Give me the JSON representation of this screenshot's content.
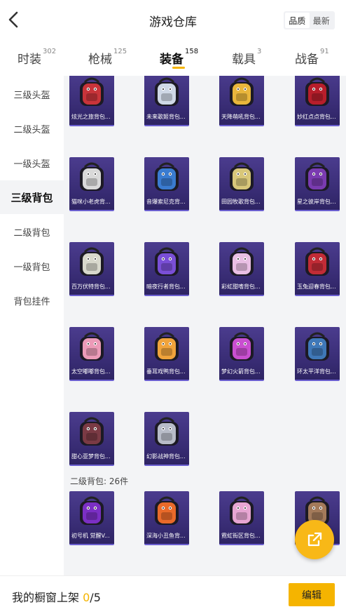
{
  "header": {
    "title": "游戏仓库",
    "sort_options": [
      "品质",
      "最新"
    ],
    "sort_selected": "品质"
  },
  "tabs": [
    {
      "label": "时装",
      "count": "302"
    },
    {
      "label": "枪械",
      "count": "125"
    },
    {
      "label": "装备",
      "count": "158",
      "active": true
    },
    {
      "label": "载具",
      "count": "3"
    },
    {
      "label": "战备",
      "count": "91"
    }
  ],
  "sidebar": {
    "items": [
      "三级头盔",
      "二级头盔",
      "一级头盔",
      "三级背包",
      "二级背包",
      "一级背包",
      "背包挂件"
    ],
    "active_index": 3
  },
  "items": [
    {
      "name": "炫光之旅背包...",
      "icon": "red-monster-backpack-icon",
      "color": "#c8343a"
    },
    {
      "name": "未来歌姬背包...",
      "icon": "white-idol-backpack-icon",
      "color": "#cfd8e6"
    },
    {
      "name": "天降萌吼背包...",
      "icon": "yellow-bear-backpack-icon",
      "color": "#e9b63c"
    },
    {
      "name": "妙红点点背包...",
      "icon": "red-dot-backpack-icon",
      "color": "#b71e2b"
    },
    {
      "name": "猫咪小老虎背...",
      "icon": "tiger-cat-backpack-icon",
      "color": "#d9d9d9"
    },
    {
      "name": "音爆索尼克背...",
      "icon": "sonic-robot-backpack-icon",
      "color": "#3a7bd0"
    },
    {
      "name": "田园牧歌背包...",
      "icon": "pastoral-basket-backpack-icon",
      "color": "#d8c77a"
    },
    {
      "name": "星之彼岸背包...",
      "icon": "star-shore-backpack-icon",
      "color": "#7a3bb0"
    },
    {
      "name": "百万伏特背包...",
      "icon": "volt-backpack-icon",
      "color": "#d8d8cc"
    },
    {
      "name": "暗夜行者背包...",
      "icon": "night-walker-backpack-icon",
      "color": "#7a4fd6"
    },
    {
      "name": "彩虹甜嗜背包...",
      "icon": "rainbow-bunny-backpack-icon",
      "color": "#e9bfe4"
    },
    {
      "name": "玉兔迎春背包...",
      "icon": "jade-rabbit-backpack-icon",
      "color": "#c12c36"
    },
    {
      "name": "太空嘟嘟背包...",
      "icon": "space-dudu-backpack-icon",
      "color": "#ec9bb8"
    },
    {
      "name": "垂耳戏鸭背包...",
      "icon": "floppy-duck-backpack-icon",
      "color": "#f0a33b"
    },
    {
      "name": "梦幻火箭背包...",
      "icon": "dream-rocket-backpack-icon",
      "color": "#c94fd0"
    },
    {
      "name": "环太平洋背包...",
      "icon": "pacific-rim-backpack-icon",
      "color": "#3f78b8"
    },
    {
      "name": "甜心亚梦背包...",
      "icon": "sweetheart-dream-backpack-icon",
      "color": "#7a3a44"
    },
    {
      "name": "幻影战神背包...",
      "icon": "phantom-war-backpack-icon",
      "color": "#b8bcc8"
    }
  ],
  "section2": {
    "label": "二级背包: 26件",
    "items": [
      {
        "name": "初号机 觉醒V...",
        "icon": "eva-unit01-backpack-icon",
        "color": "#7b2fc4"
      },
      {
        "name": "深海小丑鱼背...",
        "icon": "clownfish-backpack-icon",
        "color": "#e96a2a"
      },
      {
        "name": "霓虹街区背包...",
        "icon": "neon-street-backpack-icon",
        "color": "#e7a5d2"
      },
      {
        "name": "...",
        "icon": "hidden-backpack-icon",
        "color": "#a37a5a"
      }
    ]
  },
  "bottom": {
    "label": "我的橱窗上架",
    "current": "0",
    "total": "/5",
    "edit_label": "编辑"
  },
  "colors": {
    "accent": "#f5b400",
    "card_bg": "#3a2d77",
    "content_bg": "#f3f4f6"
  },
  "fab_icon": "share-out-icon"
}
